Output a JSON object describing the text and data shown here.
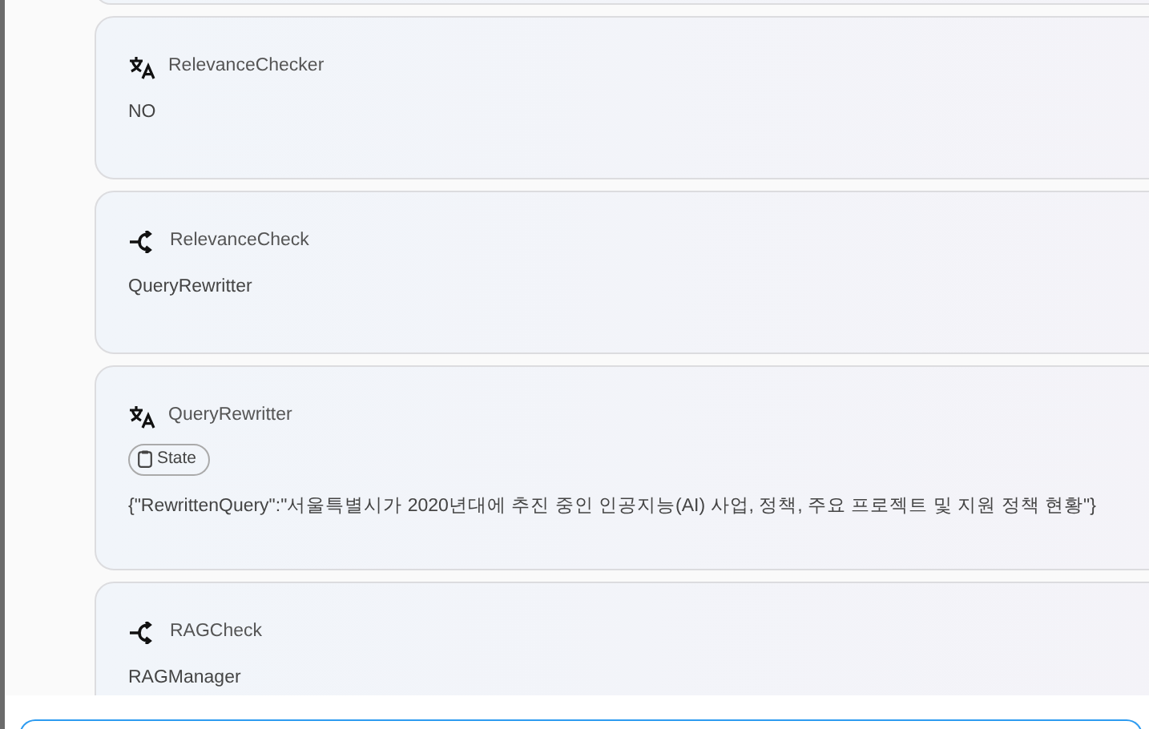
{
  "steps": [
    {
      "kind": "translate",
      "title": "RelevanceChecker",
      "body": "NO"
    },
    {
      "kind": "branch",
      "title": "RelevanceCheck",
      "body": "QueryRewritter"
    },
    {
      "kind": "translate",
      "title": "QueryRewritter",
      "chip": "State",
      "body": "{\"RewrittenQuery\":\"서울특별시가 2020년대에 추진 중인 인공지능(AI) 사업, 정책, 주요 프로젝트 및 지원 정책 현황\"}"
    },
    {
      "kind": "branch",
      "title": "RAGCheck",
      "body": "RAGManager"
    }
  ],
  "composer": {
    "kind": "input"
  }
}
